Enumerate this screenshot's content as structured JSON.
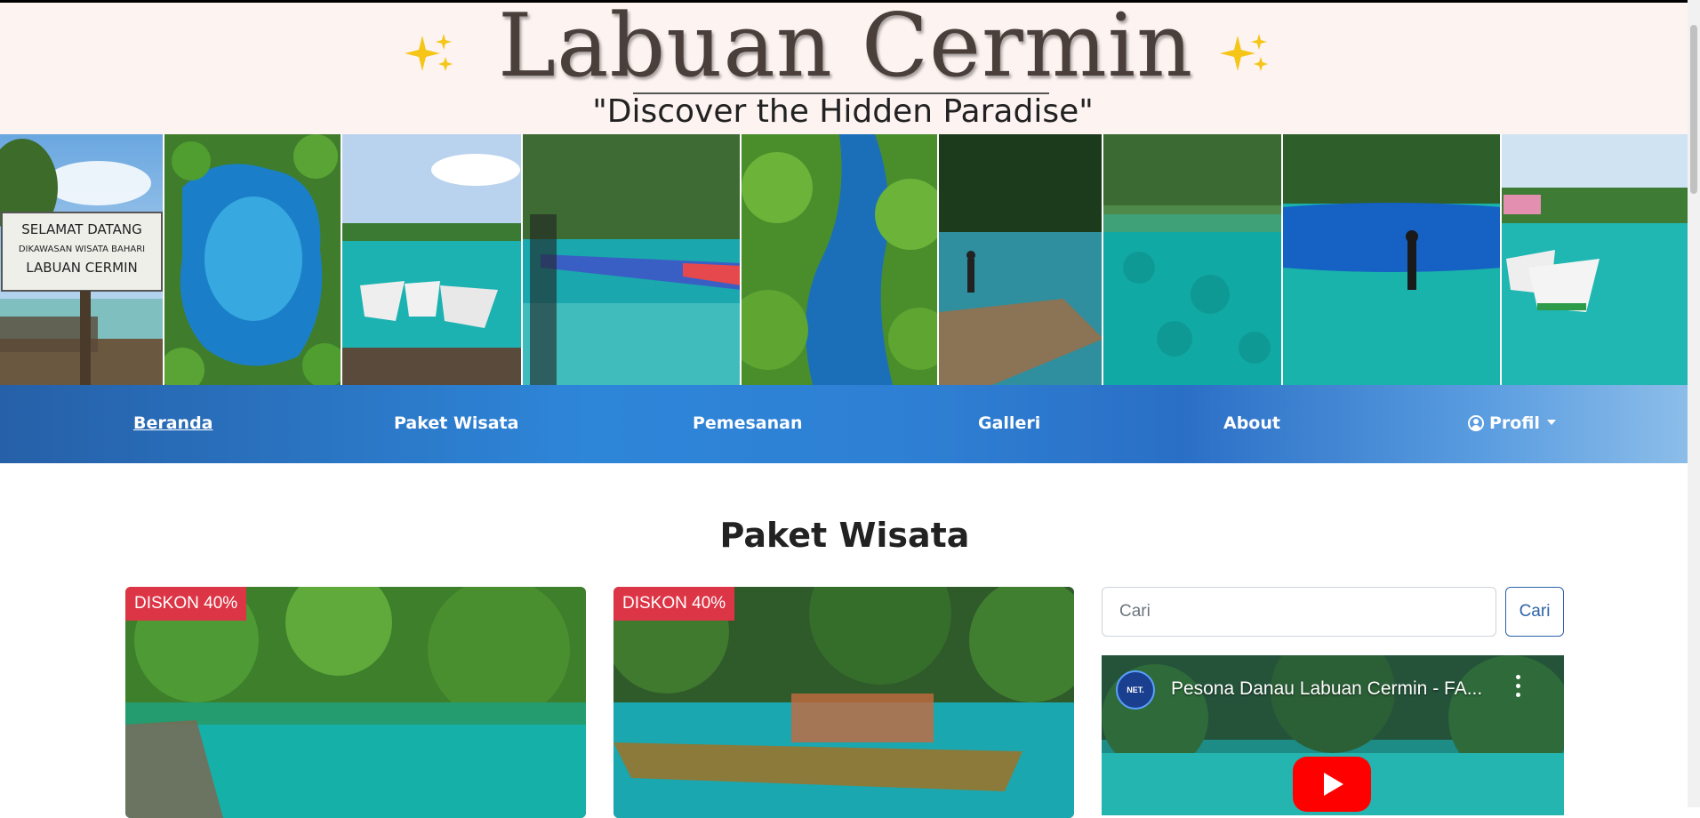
{
  "header": {
    "title": "Labuan Cermin",
    "tagline": "\"Discover the Hidden Paradise\""
  },
  "nav": {
    "items": [
      {
        "label": "Beranda",
        "active": true
      },
      {
        "label": "Paket Wisata"
      },
      {
        "label": "Pemesanan"
      },
      {
        "label": "Galleri"
      },
      {
        "label": "About"
      }
    ],
    "profile_label": "Profil"
  },
  "photo_strip": {
    "photos": [
      {
        "sign_lines": [
          "SELAMAT DATANG",
          "DIKAWASAN WISATA BAHARI",
          "LABUAN CERMIN"
        ]
      },
      {},
      {},
      {},
      {},
      {},
      {},
      {},
      {}
    ]
  },
  "main": {
    "section_title": "Paket Wisata",
    "cards": [
      {
        "badge": "DISKON 40%"
      },
      {
        "badge": "DISKON 40%"
      }
    ],
    "search": {
      "placeholder": "Cari",
      "button_label": "Cari"
    },
    "video": {
      "title": "Pesona Danau Labuan Cermin - FA...",
      "channel": "NET."
    }
  },
  "colors": {
    "header_bg": "#fdf3f1",
    "nav_start": "#2660a8",
    "nav_end": "#8cbde9",
    "badge": "#dc3545",
    "accent": "#2d63a8",
    "lagoon": "#1fb6b3"
  }
}
